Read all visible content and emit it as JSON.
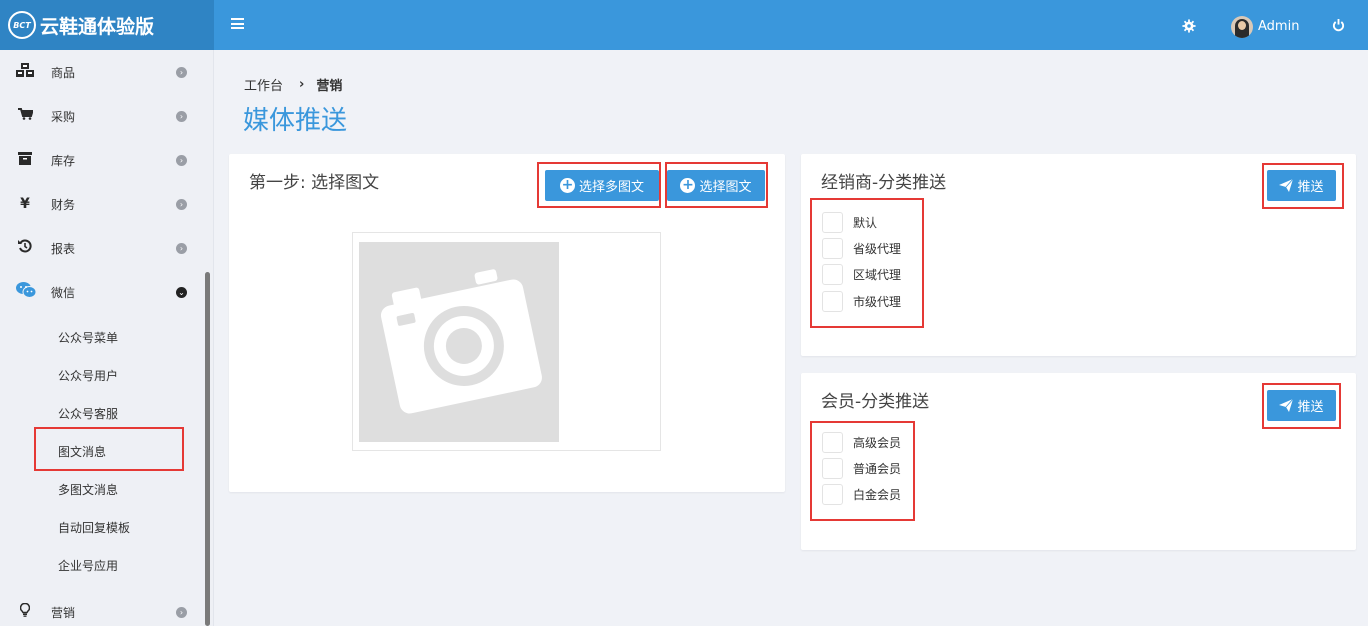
{
  "brand": {
    "logo_text": "BCT",
    "name": "云鞋通体验版"
  },
  "topbar": {
    "user_name": "Admin"
  },
  "sidebar": {
    "items": [
      {
        "label": "商品",
        "icon": "cubes-icon"
      },
      {
        "label": "采购",
        "icon": "cart-icon"
      },
      {
        "label": "库存",
        "icon": "archive-icon"
      },
      {
        "label": "财务",
        "icon": "yen-icon",
        "glyph": "¥"
      },
      {
        "label": "报表",
        "icon": "history-icon"
      },
      {
        "label": "微信",
        "icon": "wechat-icon"
      },
      {
        "label": "营销",
        "icon": "lightbulb-icon"
      }
    ],
    "wechat_sub": [
      "公众号菜单",
      "公众号用户",
      "公众号客服",
      "图文消息",
      "多图文消息",
      "自动回复模板",
      "企业号应用"
    ]
  },
  "breadcrumb": {
    "home": "工作台",
    "current": "营销"
  },
  "page_title": "媒体推送",
  "step_panel": {
    "title": "第一步: 选择图文",
    "btn_multi": "选择多图文",
    "btn_single": "选择图文"
  },
  "dealer_panel": {
    "title": "经销商-分类推送",
    "push_btn": "推送",
    "options": [
      "默认",
      "省级代理",
      "区域代理",
      "市级代理"
    ]
  },
  "member_panel": {
    "title": "会员-分类推送",
    "push_btn": "推送",
    "options": [
      "高级会员",
      "普通会员",
      "白金会员"
    ]
  },
  "colors": {
    "accent": "#3a97dc",
    "brand_bg": "#2f84c4",
    "highlight": "#e53935"
  }
}
